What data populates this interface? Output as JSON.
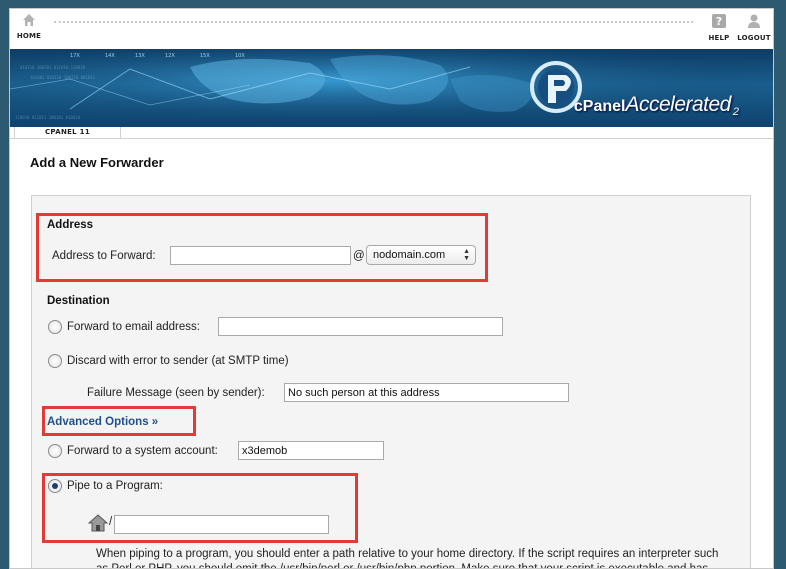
{
  "nav": {
    "home_label": "HOME",
    "help_label": "HELP",
    "logout_label": "LOGOUT"
  },
  "banner": {
    "brand_prefix": "cPanel",
    "brand_name": "Accelerated",
    "brand_version": "2",
    "tickers": [
      "17X",
      "14X",
      "13X",
      "12X",
      "15X",
      "10X"
    ]
  },
  "tab": {
    "label": "CPANEL 11"
  },
  "page": {
    "title": "Add a New Forwarder"
  },
  "address": {
    "heading": "Address",
    "forward_label": "Address to Forward:",
    "forward_value": "",
    "at_sign": "@",
    "domain_selected": "nodomain.com"
  },
  "destination": {
    "heading": "Destination",
    "email_option_label": "Forward to email address:",
    "email_value": "",
    "discard_option_label": "Discard with error to sender (at SMTP time)",
    "failure_label": "Failure Message (seen by sender):",
    "failure_value": "No such person at this address",
    "advanced_link": "Advanced Options »",
    "system_option_label": "Forward to a system account:",
    "system_value": "x3demob",
    "pipe_option_label": "Pipe to a Program:",
    "pipe_separator": "/",
    "pipe_value": "",
    "help_text": "When piping to a program, you should enter a path relative to your home directory. If the script requires an interpreter such as Perl or PHP, you should omit the /usr/bin/perl or /usr/bin/php portion. Make sure that your script is executable and has the appropriate hashbang at the top of the script."
  },
  "colors": {
    "highlight": "#e23b37",
    "link": "#21508c",
    "panel": "#f4f4f4",
    "background": "#2d5a70"
  }
}
